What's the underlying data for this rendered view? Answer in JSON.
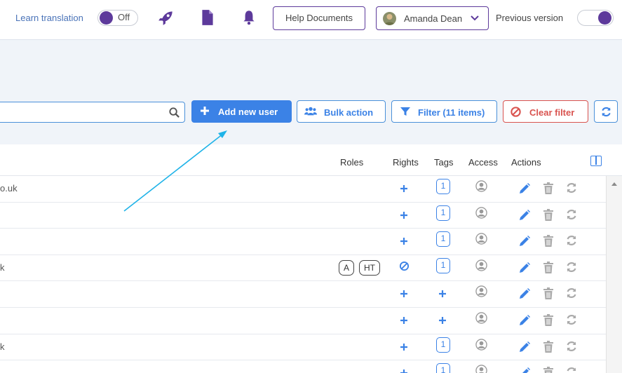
{
  "header": {
    "learn_translation_label": "Learn translation",
    "learn_translation_state": "Off",
    "icons": [
      "rocket-icon",
      "document-icon",
      "bell-icon"
    ],
    "help_button": "Help Documents",
    "user_name": "Amanda Dean",
    "previous_version_label": "Previous version",
    "accent_color": "#5d3a9b"
  },
  "toolbar": {
    "search_placeholder": "",
    "add_user": "Add new user",
    "bulk_action": "Bulk action",
    "filter": "Filter (11 items)",
    "clear_filter": "Clear filter",
    "primary_color": "#3b82e6",
    "danger_color": "#d9534f"
  },
  "table": {
    "columns": [
      "Roles",
      "Rights",
      "Tags",
      "Access",
      "Actions"
    ],
    "rows": [
      {
        "email": "o.uk",
        "roles": [],
        "rights": "plus",
        "tags": "1"
      },
      {
        "email": "",
        "roles": [],
        "rights": "plus",
        "tags": "1"
      },
      {
        "email": "",
        "roles": [],
        "rights": "plus",
        "tags": "1"
      },
      {
        "email": "k",
        "roles": [
          "A",
          "HT"
        ],
        "rights": "ban",
        "tags": "1"
      },
      {
        "email": "",
        "roles": [],
        "rights": "plus",
        "tags": "plus"
      },
      {
        "email": "",
        "roles": [],
        "rights": "plus",
        "tags": "plus"
      },
      {
        "email": "k",
        "roles": [],
        "rights": "plus",
        "tags": "1"
      },
      {
        "email": "",
        "roles": [],
        "rights": "plus",
        "tags": "1"
      }
    ]
  }
}
